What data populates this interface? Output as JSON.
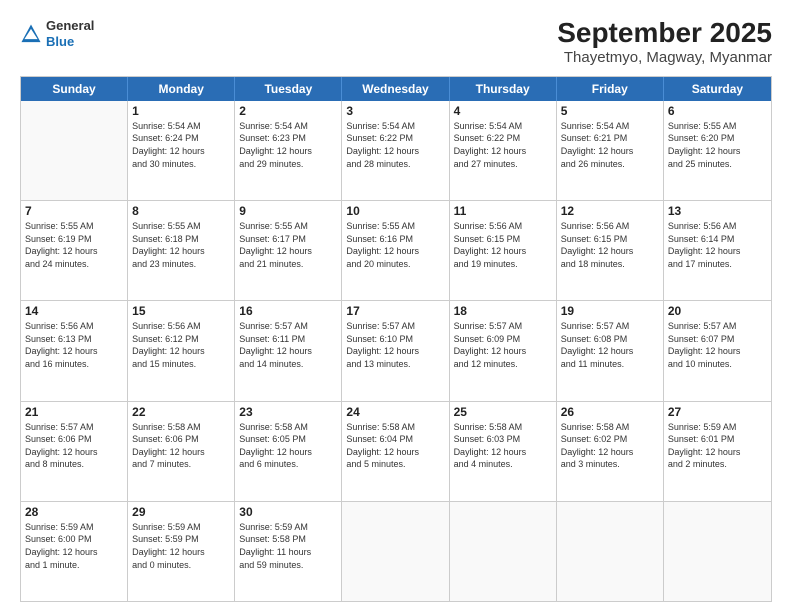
{
  "header": {
    "logo": {
      "line1": "General",
      "line2": "Blue"
    },
    "title": "September 2025",
    "subtitle": "Thayetmyo, Magway, Myanmar"
  },
  "calendar": {
    "days": [
      "Sunday",
      "Monday",
      "Tuesday",
      "Wednesday",
      "Thursday",
      "Friday",
      "Saturday"
    ],
    "weeks": [
      [
        {
          "day": "",
          "info": ""
        },
        {
          "day": "1",
          "info": "Sunrise: 5:54 AM\nSunset: 6:24 PM\nDaylight: 12 hours\nand 30 minutes."
        },
        {
          "day": "2",
          "info": "Sunrise: 5:54 AM\nSunset: 6:23 PM\nDaylight: 12 hours\nand 29 minutes."
        },
        {
          "day": "3",
          "info": "Sunrise: 5:54 AM\nSunset: 6:22 PM\nDaylight: 12 hours\nand 28 minutes."
        },
        {
          "day": "4",
          "info": "Sunrise: 5:54 AM\nSunset: 6:22 PM\nDaylight: 12 hours\nand 27 minutes."
        },
        {
          "day": "5",
          "info": "Sunrise: 5:54 AM\nSunset: 6:21 PM\nDaylight: 12 hours\nand 26 minutes."
        },
        {
          "day": "6",
          "info": "Sunrise: 5:55 AM\nSunset: 6:20 PM\nDaylight: 12 hours\nand 25 minutes."
        }
      ],
      [
        {
          "day": "7",
          "info": "Sunrise: 5:55 AM\nSunset: 6:19 PM\nDaylight: 12 hours\nand 24 minutes."
        },
        {
          "day": "8",
          "info": "Sunrise: 5:55 AM\nSunset: 6:18 PM\nDaylight: 12 hours\nand 23 minutes."
        },
        {
          "day": "9",
          "info": "Sunrise: 5:55 AM\nSunset: 6:17 PM\nDaylight: 12 hours\nand 21 minutes."
        },
        {
          "day": "10",
          "info": "Sunrise: 5:55 AM\nSunset: 6:16 PM\nDaylight: 12 hours\nand 20 minutes."
        },
        {
          "day": "11",
          "info": "Sunrise: 5:56 AM\nSunset: 6:15 PM\nDaylight: 12 hours\nand 19 minutes."
        },
        {
          "day": "12",
          "info": "Sunrise: 5:56 AM\nSunset: 6:15 PM\nDaylight: 12 hours\nand 18 minutes."
        },
        {
          "day": "13",
          "info": "Sunrise: 5:56 AM\nSunset: 6:14 PM\nDaylight: 12 hours\nand 17 minutes."
        }
      ],
      [
        {
          "day": "14",
          "info": "Sunrise: 5:56 AM\nSunset: 6:13 PM\nDaylight: 12 hours\nand 16 minutes."
        },
        {
          "day": "15",
          "info": "Sunrise: 5:56 AM\nSunset: 6:12 PM\nDaylight: 12 hours\nand 15 minutes."
        },
        {
          "day": "16",
          "info": "Sunrise: 5:57 AM\nSunset: 6:11 PM\nDaylight: 12 hours\nand 14 minutes."
        },
        {
          "day": "17",
          "info": "Sunrise: 5:57 AM\nSunset: 6:10 PM\nDaylight: 12 hours\nand 13 minutes."
        },
        {
          "day": "18",
          "info": "Sunrise: 5:57 AM\nSunset: 6:09 PM\nDaylight: 12 hours\nand 12 minutes."
        },
        {
          "day": "19",
          "info": "Sunrise: 5:57 AM\nSunset: 6:08 PM\nDaylight: 12 hours\nand 11 minutes."
        },
        {
          "day": "20",
          "info": "Sunrise: 5:57 AM\nSunset: 6:07 PM\nDaylight: 12 hours\nand 10 minutes."
        }
      ],
      [
        {
          "day": "21",
          "info": "Sunrise: 5:57 AM\nSunset: 6:06 PM\nDaylight: 12 hours\nand 8 minutes."
        },
        {
          "day": "22",
          "info": "Sunrise: 5:58 AM\nSunset: 6:06 PM\nDaylight: 12 hours\nand 7 minutes."
        },
        {
          "day": "23",
          "info": "Sunrise: 5:58 AM\nSunset: 6:05 PM\nDaylight: 12 hours\nand 6 minutes."
        },
        {
          "day": "24",
          "info": "Sunrise: 5:58 AM\nSunset: 6:04 PM\nDaylight: 12 hours\nand 5 minutes."
        },
        {
          "day": "25",
          "info": "Sunrise: 5:58 AM\nSunset: 6:03 PM\nDaylight: 12 hours\nand 4 minutes."
        },
        {
          "day": "26",
          "info": "Sunrise: 5:58 AM\nSunset: 6:02 PM\nDaylight: 12 hours\nand 3 minutes."
        },
        {
          "day": "27",
          "info": "Sunrise: 5:59 AM\nSunset: 6:01 PM\nDaylight: 12 hours\nand 2 minutes."
        }
      ],
      [
        {
          "day": "28",
          "info": "Sunrise: 5:59 AM\nSunset: 6:00 PM\nDaylight: 12 hours\nand 1 minute."
        },
        {
          "day": "29",
          "info": "Sunrise: 5:59 AM\nSunset: 5:59 PM\nDaylight: 12 hours\nand 0 minutes."
        },
        {
          "day": "30",
          "info": "Sunrise: 5:59 AM\nSunset: 5:58 PM\nDaylight: 11 hours\nand 59 minutes."
        },
        {
          "day": "",
          "info": ""
        },
        {
          "day": "",
          "info": ""
        },
        {
          "day": "",
          "info": ""
        },
        {
          "day": "",
          "info": ""
        }
      ]
    ]
  }
}
